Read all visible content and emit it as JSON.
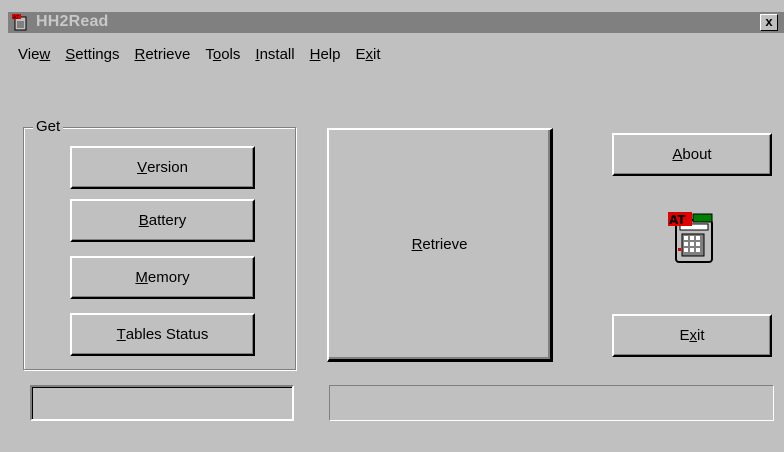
{
  "window": {
    "title": "HH2Read",
    "close_label": "x",
    "app_icon": "handheld-calculator-icon"
  },
  "menu": [
    {
      "pre": "Vie",
      "key": "w",
      "post": ""
    },
    {
      "pre": "",
      "key": "S",
      "post": "ettings"
    },
    {
      "pre": "",
      "key": "R",
      "post": "etrieve"
    },
    {
      "pre": "T",
      "key": "o",
      "post": "ols"
    },
    {
      "pre": "",
      "key": "I",
      "post": "nstall"
    },
    {
      "pre": "",
      "key": "H",
      "post": "elp"
    },
    {
      "pre": "E",
      "key": "x",
      "post": "it"
    }
  ],
  "group": {
    "label": "Get",
    "buttons": {
      "version": {
        "pre": "",
        "key": "V",
        "post": "ersion"
      },
      "battery": {
        "pre": "",
        "key": "B",
        "post": "attery"
      },
      "memory": {
        "pre": "",
        "key": "M",
        "post": "emory"
      },
      "tables": {
        "pre": "",
        "key": "T",
        "post": "ables Status"
      }
    }
  },
  "retrieve_button": {
    "pre": "",
    "key": "R",
    "post": "etrieve"
  },
  "about_button": {
    "pre": "",
    "key": "A",
    "post": "bout"
  },
  "exit_button": {
    "pre": "E",
    "key": "x",
    "post": "it"
  },
  "status": {
    "left": "",
    "right": ""
  },
  "colors": {
    "face": "#c0c0c0",
    "titlebar_inactive": "#808080",
    "icon_red": "#e00000",
    "icon_green": "#008000"
  }
}
